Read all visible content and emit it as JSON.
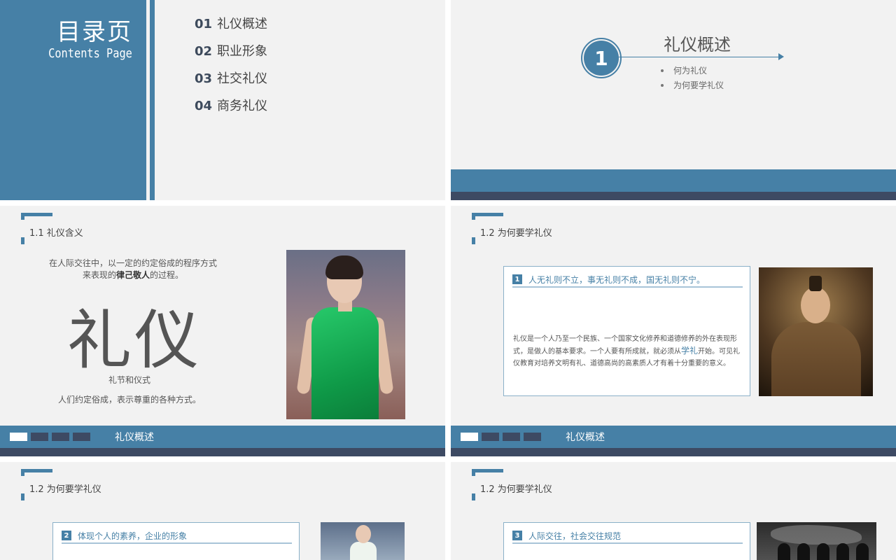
{
  "slide1": {
    "title": "目录页",
    "subtitle": "Contents Page",
    "items": [
      {
        "num": "01",
        "label": "礼仪概述"
      },
      {
        "num": "02",
        "label": "职业形象"
      },
      {
        "num": "03",
        "label": "社交礼仪"
      },
      {
        "num": "04",
        "label": "商务礼仪"
      }
    ]
  },
  "slide2": {
    "number": "1",
    "title": "礼仪概述",
    "bullets": [
      "何为礼仪",
      "为何要学礼仪"
    ]
  },
  "slide3": {
    "heading": "1.1  礼仪含义",
    "desc_pre": "在人际交往中，以一定的约定俗成的程序方式来表现的",
    "desc_bold": "律己敬人",
    "desc_post": "的过程。",
    "big_word": "礼仪",
    "note1": "礼节和仪式",
    "note2": "人们约定俗成，表示尊重的各种方式。",
    "nav_label": "礼仪概述"
  },
  "slide4": {
    "heading": "1.2 为何要学礼仪",
    "badge": "1",
    "card_title": "人无礼则不立，事无礼则不成，国无礼则不宁。",
    "body_pre": "礼仪是一个人乃至一个民族、一个国家文化修养和道德修养的外在表现形式，是做人的基本要求。一个人要有所成就，就必须从",
    "body_hl": "学礼",
    "body_post": "开始。可见礼仪教育对培养文明有礼、道德高尚的高素质人才有着十分重要的意义。",
    "nav_label": "礼仪概述"
  },
  "slide5": {
    "heading": "1.2 为何要学礼仪",
    "badge": "2",
    "card_title": "体现个人的素养，企业的形象"
  },
  "slide6": {
    "heading": "1.2 为何要学礼仪",
    "badge": "3",
    "card_title": "人际交往，社会交往规范"
  },
  "colors": {
    "accent": "#4680a6",
    "dark": "#3d4a63",
    "background": "#f2f2f2"
  }
}
